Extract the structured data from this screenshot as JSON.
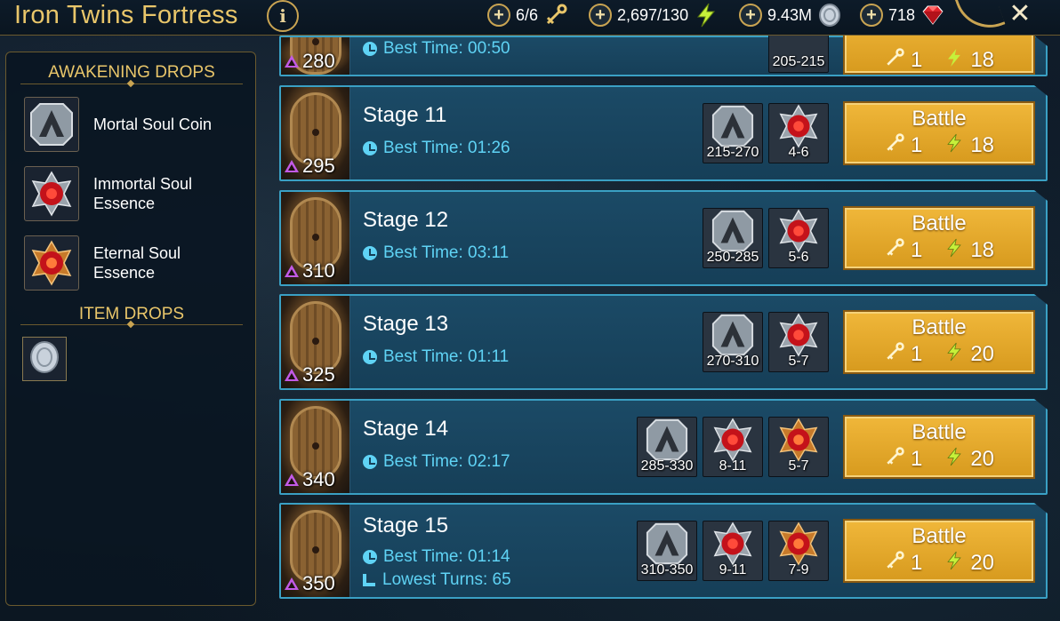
{
  "header": {
    "title": "Iron Twins Fortress",
    "info_label": "i",
    "resources": [
      {
        "name": "keys",
        "value": "6/6",
        "icon": "key-icon"
      },
      {
        "name": "energy",
        "value": "2,697/130",
        "icon": "lightning-icon"
      },
      {
        "name": "silver",
        "value": "9.43M",
        "icon": "silver-coin-icon"
      },
      {
        "name": "gems",
        "value": "718",
        "icon": "ruby-gem-icon"
      }
    ],
    "plus_label": "+",
    "close_label": "✕"
  },
  "sidebar": {
    "awakening_heading": "AWAKENING DROPS",
    "awakening_items": [
      {
        "label": "Mortal Soul Coin",
        "icon": "mortal-soul-coin-icon"
      },
      {
        "label": "Immortal Soul Essence",
        "icon": "immortal-soul-essence-icon"
      },
      {
        "label": "Eternal Soul Essence",
        "icon": "eternal-soul-essence-icon"
      }
    ],
    "item_heading": "ITEM DROPS",
    "item_icon": "silver-coin-icon"
  },
  "stages": {
    "battle_label": "Battle",
    "best_time_prefix": "Best Time: ",
    "lowest_turns_prefix": "Lowest Turns: ",
    "partial": {
      "level": "280",
      "best_time": "Best Time: 00:50",
      "reward": "205-215",
      "key_cost": "1",
      "energy_cost": "18"
    },
    "rows": [
      {
        "name": "Stage 11",
        "level": "295",
        "best_time": "Best Time: 01:26",
        "rewards": [
          {
            "type": "mortal",
            "range": "215-270"
          },
          {
            "type": "immortal",
            "range": "4-6"
          }
        ],
        "key_cost": "1",
        "energy_cost": "18"
      },
      {
        "name": "Stage 12",
        "level": "310",
        "best_time": "Best Time: 03:11",
        "rewards": [
          {
            "type": "mortal",
            "range": "250-285"
          },
          {
            "type": "immortal",
            "range": "5-6"
          }
        ],
        "key_cost": "1",
        "energy_cost": "18"
      },
      {
        "name": "Stage 13",
        "level": "325",
        "best_time": "Best Time: 01:11",
        "rewards": [
          {
            "type": "mortal",
            "range": "270-310"
          },
          {
            "type": "immortal",
            "range": "5-7"
          }
        ],
        "key_cost": "1",
        "energy_cost": "20"
      },
      {
        "name": "Stage 14",
        "level": "340",
        "best_time": "Best Time: 02:17",
        "rewards": [
          {
            "type": "mortal",
            "range": "285-330"
          },
          {
            "type": "immortal",
            "range": "8-11"
          },
          {
            "type": "eternal",
            "range": "5-7"
          }
        ],
        "key_cost": "1",
        "energy_cost": "20"
      },
      {
        "name": "Stage 15",
        "level": "350",
        "best_time": "Best Time: 01:14",
        "lowest_turns": "Lowest Turns: 65",
        "rewards": [
          {
            "type": "mortal",
            "range": "310-350"
          },
          {
            "type": "immortal",
            "range": "9-11"
          },
          {
            "type": "eternal",
            "range": "7-9"
          }
        ],
        "key_cost": "1",
        "energy_cost": "20"
      }
    ]
  },
  "colors": {
    "gold": "#e9c66a",
    "row_bg": "#1b4a66",
    "row_border": "#3aa0c4",
    "cyan_text": "#5fd3f5",
    "battle_bg": "#f0b73a",
    "level_triangle": "#c25ae6"
  }
}
